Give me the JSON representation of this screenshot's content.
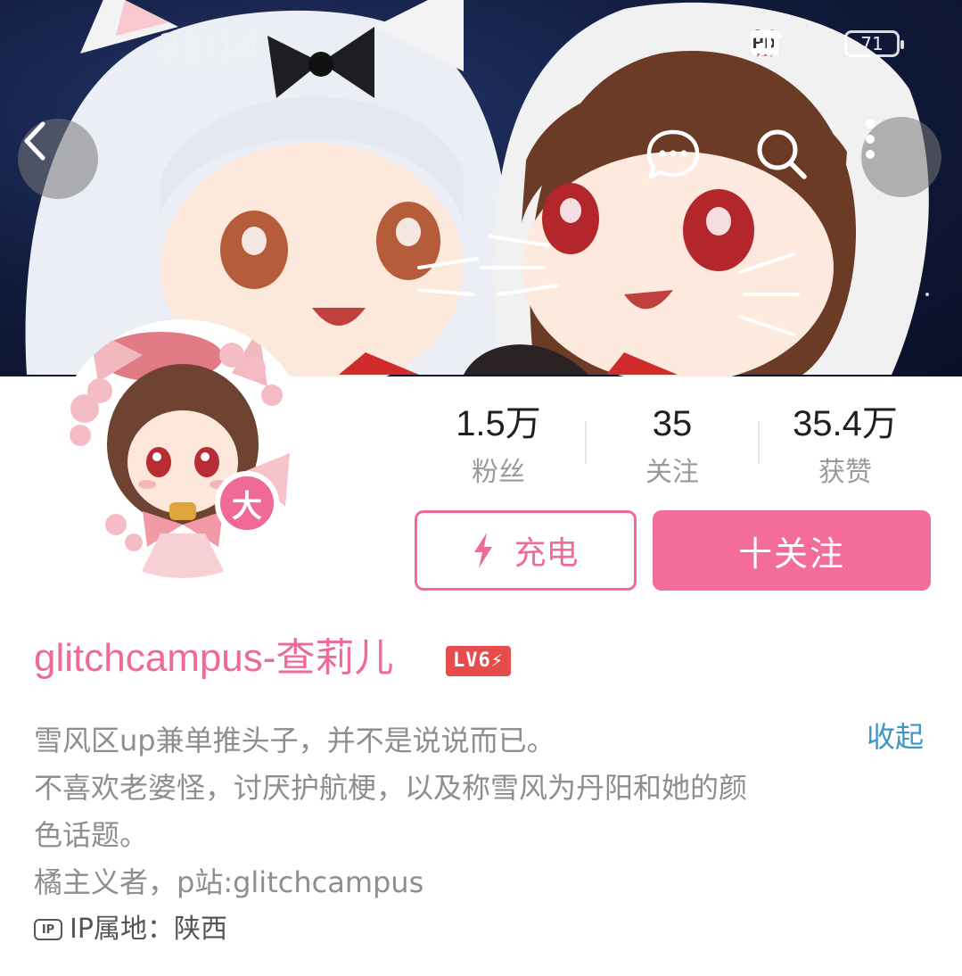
{
  "status_bar": {
    "time": "21:14",
    "icons": [
      "alarm-icon",
      "wifi-icon",
      "hd-icon",
      "signal-4g-icon"
    ],
    "battery": "71"
  },
  "nav": {
    "back_icon": "chevron-left-icon",
    "chat_icon": "chat-bubble-icon",
    "search_icon": "search-icon",
    "more_icon": "more-vertical-icon"
  },
  "avatar": {
    "badge": "大"
  },
  "stats": {
    "fans_value": "1.5万",
    "fans_label": "粉丝",
    "following_value": "35",
    "following_label": "关注",
    "likes_value": "35.4万",
    "likes_label": "获赞"
  },
  "actions": {
    "charge_label": "充电",
    "follow_label": "十关注"
  },
  "profile": {
    "username": "glitchcampus-查莉儿",
    "level": "LV6",
    "bio_lines": [
      "雪风区up兼单推头子，并不是说说而已。",
      "不喜欢老婆怪，讨厌护航梗，以及称雪风为丹阳和她的颜",
      "色话题。",
      "橘主义者，p站:glitchcampus"
    ],
    "collapse_label": "收起",
    "ip_icon": "IP",
    "ip_location": "IP属地：陕西"
  },
  "colors": {
    "accent_pink": "#f06a97",
    "follow_button": "#f46d99",
    "link_blue": "#3f95c4",
    "level_badge": "#e64c4c"
  }
}
